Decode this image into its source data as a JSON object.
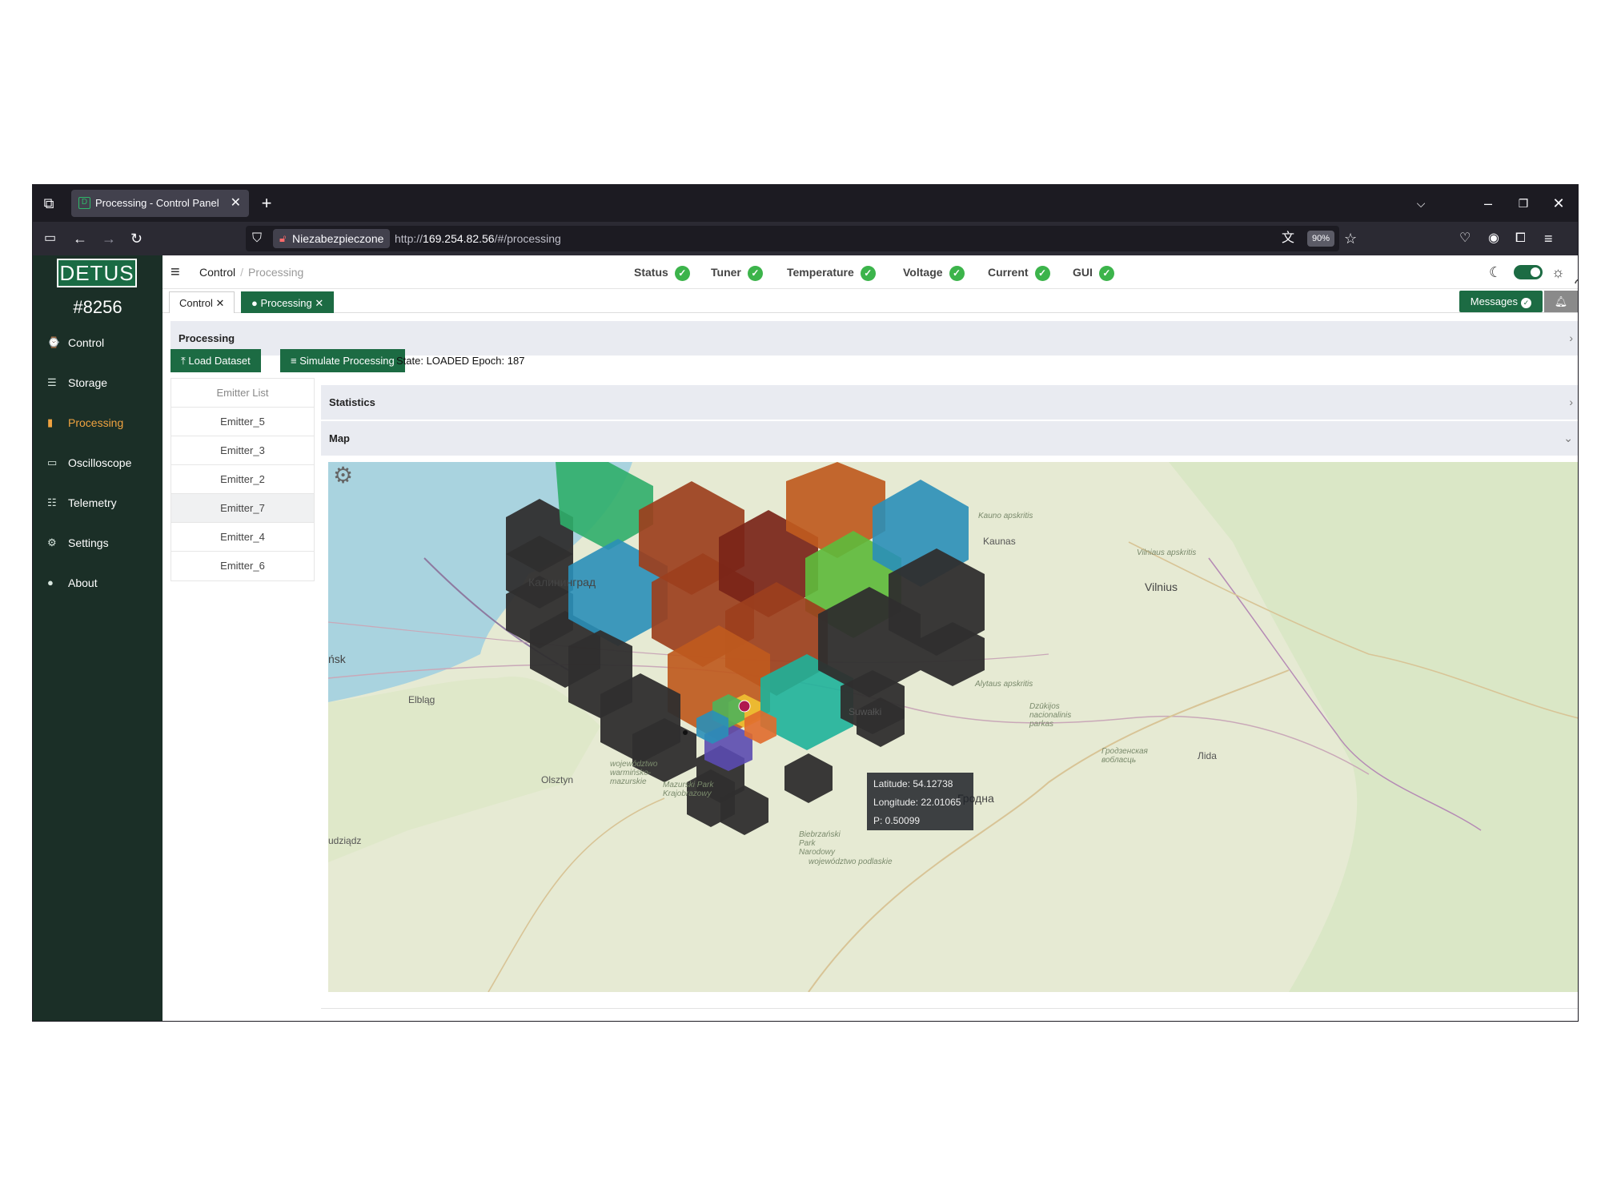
{
  "browser": {
    "tab_title": "Processing - Control Panel",
    "tab_favicon": "D",
    "security_label": "Niezabezpieczone",
    "url_prefix": "http://",
    "url_host": "169.254.82.56",
    "url_path": "/#/processing",
    "zoom": "90%"
  },
  "sidebar": {
    "logo": "DETUS",
    "device_id": "#8256",
    "items": [
      {
        "label": "Control",
        "icon": "dashboard-icon"
      },
      {
        "label": "Storage",
        "icon": "database-icon"
      },
      {
        "label": "Processing",
        "icon": "bar-chart-icon",
        "active": true
      },
      {
        "label": "Oscilloscope",
        "icon": "monitor-icon"
      },
      {
        "label": "Telemetry",
        "icon": "list-icon"
      },
      {
        "label": "Settings",
        "icon": "gear-icon"
      },
      {
        "label": "About",
        "icon": "info-icon"
      }
    ]
  },
  "header": {
    "breadcrumb_root": "Control",
    "breadcrumb_sep": "/",
    "breadcrumb_current": "Processing",
    "statuses": [
      {
        "label": "Status",
        "ok": "✓"
      },
      {
        "label": "Tuner",
        "ok": "✓"
      },
      {
        "label": "Temperature",
        "ok": "✓"
      },
      {
        "label": "Voltage",
        "ok": "✓"
      },
      {
        "label": "Current",
        "ok": "✓"
      },
      {
        "label": "GUI",
        "ok": "✓"
      }
    ]
  },
  "page_tabs": {
    "control": "Control ✕",
    "processing": "● Processing ✕",
    "messages": "Messages"
  },
  "panel": {
    "title": "Processing",
    "load_button": "⤒ Load Dataset",
    "simulate_button": "≡ Simulate Processing",
    "state_text": "State: LOADED Epoch: 187",
    "statistics_title": "Statistics",
    "map_title": "Map"
  },
  "emitters": {
    "header": "Emitter List",
    "items": [
      "Emitter_5",
      "Emitter_3",
      "Emitter_2",
      "Emitter_7",
      "Emitter_4",
      "Emitter_6"
    ]
  },
  "map": {
    "tooltip": {
      "latitude": "Latitude: 54.12738",
      "longitude": "Longitude: 22.01065",
      "p": "P: 0.50099"
    },
    "labels": {
      "kaliningrad": "Калининград",
      "kaunas": "Kaunas",
      "vilnius": "Vilnius",
      "elblag": "Elbląg",
      "olsztyn": "Olsztyn",
      "grodno": "Гродна",
      "suwalki": "Suwałki",
      "lida": "Лida",
      "gdansk_part": "ńsk",
      "grudziadz_part": "udziądz",
      "kauno": "Kauno apskritis",
      "alytaus": "Alytaus apskritis",
      "vilniaus": "Vilniaus apskritis",
      "warminsko": "województwo warmińsko-mazurskie",
      "mazurski": "Mazurski Park Krajobrazowy",
      "biebrzanski": "Biebrzański Park Narodowy",
      "grodzenskaya": "Гродзенская вобласць",
      "dzukijos": "Dzūkijos nacionalinis parkas",
      "podlaskie": "województwo podlaskie"
    },
    "colors": {
      "dark": "#2f2e2e",
      "rust": "#9c3f1d",
      "deep_red": "#7a2418",
      "orange": "#bf5a1e",
      "green": "#2fae6a",
      "blue": "#2a8fb8",
      "lime": "#5fba3c",
      "teal": "#1eb39a"
    }
  }
}
